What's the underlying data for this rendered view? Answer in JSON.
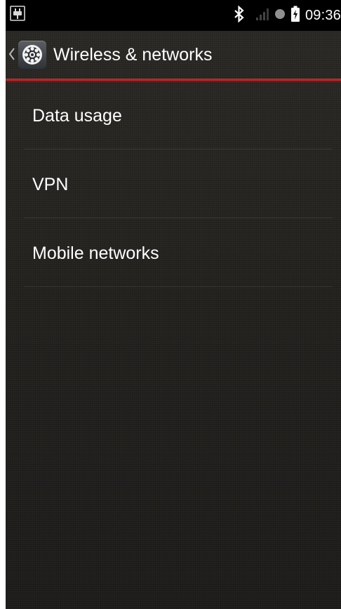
{
  "status_bar": {
    "time": "09:36",
    "icons": [
      "usb-plug-icon",
      "bluetooth-icon",
      "signal-icon",
      "sync-dot-icon",
      "battery-charging-icon"
    ]
  },
  "action_bar": {
    "title": "Wireless & networks",
    "back_icon": "chevron-left-icon",
    "app_icon": "settings-gear-icon"
  },
  "list": {
    "items": [
      {
        "label": "Data usage"
      },
      {
        "label": "VPN"
      },
      {
        "label": "Mobile networks"
      }
    ]
  },
  "colors": {
    "accent_red": "#c62020",
    "status_bar_bg": "#000000",
    "background": "#262421",
    "text": "#ffffff"
  }
}
